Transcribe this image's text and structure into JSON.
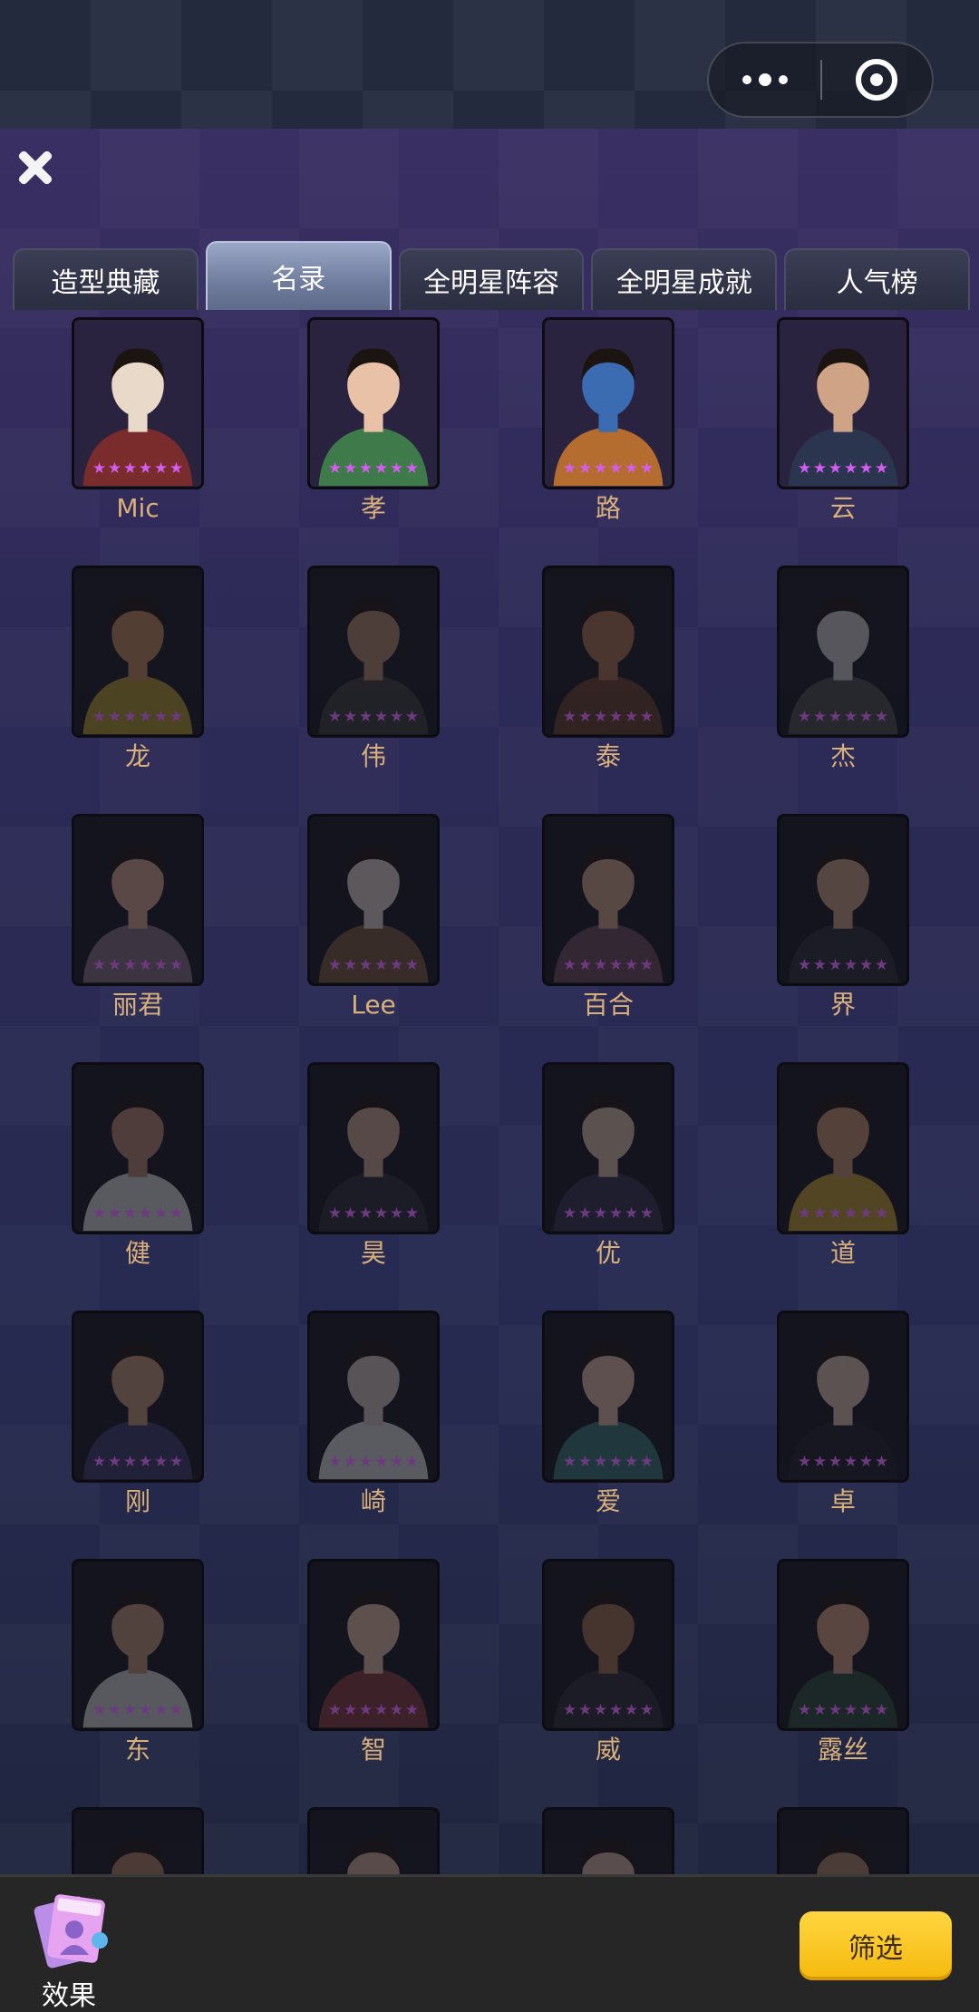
{
  "capsule": {
    "more_icon": "more-dots-icon",
    "close_icon": "target-circle-icon"
  },
  "header": {
    "close_icon": "close-x-icon"
  },
  "tabs": [
    {
      "label": "造型典藏",
      "active": false
    },
    {
      "label": "名录",
      "active": true
    },
    {
      "label": "全明星阵容",
      "active": false
    },
    {
      "label": "全明星成就",
      "active": false
    },
    {
      "label": "人气榜",
      "active": false
    }
  ],
  "stars_per_card": 6,
  "star_color": "#d45cf0",
  "name_color": "#d9b07a",
  "characters": [
    {
      "name": "Mic",
      "owned": true
    },
    {
      "name": "孝",
      "owned": true
    },
    {
      "name": "路",
      "owned": true
    },
    {
      "name": "云",
      "owned": true
    },
    {
      "name": "龙",
      "owned": false
    },
    {
      "name": "伟",
      "owned": false
    },
    {
      "name": "泰",
      "owned": false
    },
    {
      "name": "杰",
      "owned": false
    },
    {
      "name": "丽君",
      "owned": false
    },
    {
      "name": "Lee",
      "owned": false
    },
    {
      "name": "百合",
      "owned": false
    },
    {
      "name": "界",
      "owned": false
    },
    {
      "name": "健",
      "owned": false
    },
    {
      "name": "昊",
      "owned": false
    },
    {
      "name": "优",
      "owned": false
    },
    {
      "name": "道",
      "owned": false
    },
    {
      "name": "刚",
      "owned": false
    },
    {
      "name": "崎",
      "owned": false
    },
    {
      "name": "爱",
      "owned": false
    },
    {
      "name": "卓",
      "owned": false
    },
    {
      "name": "东",
      "owned": false
    },
    {
      "name": "智",
      "owned": false
    },
    {
      "name": "威",
      "owned": false
    },
    {
      "name": "露丝",
      "owned": false
    },
    {
      "name": "",
      "owned": false
    },
    {
      "name": "",
      "owned": false
    },
    {
      "name": "",
      "owned": false
    },
    {
      "name": "",
      "owned": false
    }
  ],
  "bottom_bar": {
    "effect_label": "效果",
    "effect_icon": "star-card-icon",
    "filter_label": "筛选",
    "filter_color": "#f5b90d"
  }
}
